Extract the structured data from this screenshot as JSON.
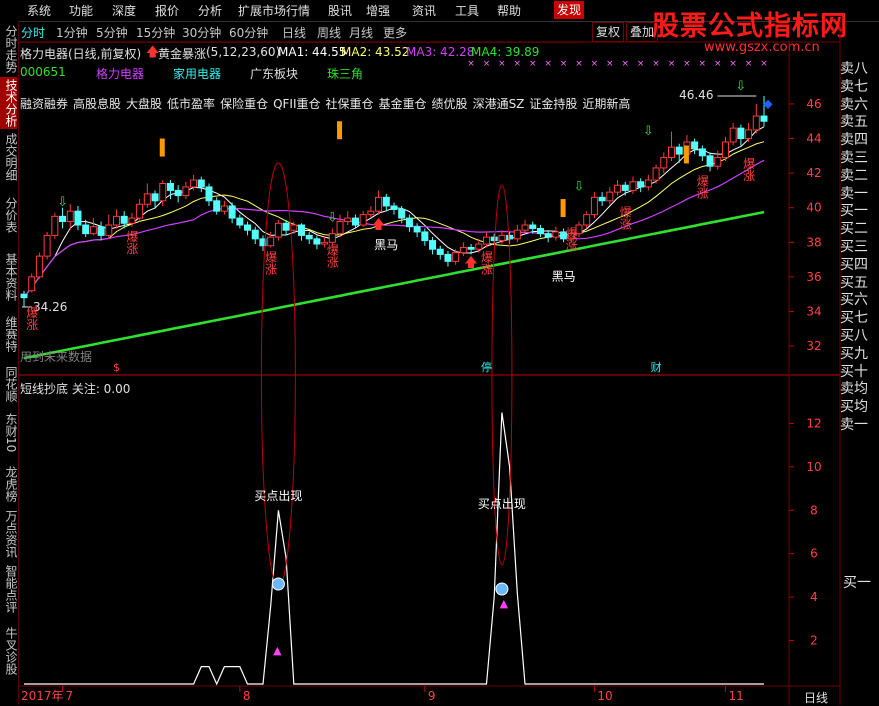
{
  "menu": [
    "系统",
    "功能",
    "深度",
    "报价",
    "分析",
    "扩展市场行情",
    "股讯",
    "增强",
    "资讯",
    "工具",
    "帮助",
    "发现"
  ],
  "logo": {
    "title": "股票公式指标网",
    "url": "www.gszx.com.cn"
  },
  "sidebar": [
    "分时走势",
    "技术分析",
    "成交明细",
    "分价表",
    "基本资料",
    "维赛特",
    "同花顺",
    "东财10",
    "龙虎榜",
    "万点资讯",
    "智能点评",
    "牛叉诊股"
  ],
  "tabs": [
    "分时",
    "1分钟",
    "5分钟",
    "15分钟",
    "30分钟",
    "60分钟",
    "日线",
    "周线",
    "月线",
    "更多"
  ],
  "toolbar": {
    "restore": "复权",
    "overlay": "叠加"
  },
  "stock": {
    "name": "格力电器(日线,前复权)",
    "indicator": "黄金暴涨",
    "params": "(5,12,23,60)",
    "ma1": "MA1: 44.55",
    "ma2": "MA2: 43.52",
    "ma3": "MA3: 42.28",
    "ma4": "MA4: 39.89",
    "code": "000651",
    "tags": [
      "格力电器",
      "家用电器",
      "广东板块",
      "珠三角"
    ]
  },
  "concepts": [
    "融资融券",
    "高股息股",
    "大盘股",
    "低市盈率",
    "保险重仓",
    "QFII重仓",
    "社保重仓",
    "基金重仓",
    "绩优股",
    "深港通SZ",
    "证金持股",
    "近期新高"
  ],
  "annotations": {
    "high": "46.46",
    "low": "34.26",
    "baozhang": "爆涨",
    "heima": "黑马",
    "future": "用到未来数据",
    "ev_s": "$",
    "ev_ting": "停",
    "ev_cai": "财",
    "buy_point": "买点出现"
  },
  "sub_title": "短线抄底 关注: 0.00",
  "orderbook": [
    "卖八",
    "卖七",
    "卖六",
    "卖五",
    "卖四",
    "卖三",
    "卖二",
    "卖一",
    "买一",
    "买二",
    "买三",
    "买四",
    "买五",
    "买六",
    "买七",
    "买八",
    "买九",
    "买十",
    "卖均",
    "买均",
    "卖一"
  ],
  "orderbook_lower": "买一",
  "bottom_period": "日线",
  "colors": {
    "up": "#ff3b3b",
    "down": "#54ffff",
    "ma1": "#ffffff",
    "ma2": "#ffff66",
    "ma3": "#d040ff",
    "ma4": "#30e030",
    "grid": "#700000"
  },
  "chart_data": {
    "type": "candlestick",
    "price_axis": {
      "ylim": [
        30.5,
        47.5
      ],
      "ticks": [
        32,
        34,
        36,
        38,
        40,
        42,
        44,
        46
      ]
    },
    "indicator_axis": {
      "ylim": [
        0,
        13.4
      ],
      "ticks": [
        2,
        4,
        6,
        8,
        10,
        12
      ]
    },
    "month_labels": [
      {
        "label": "2017年",
        "day": 0
      },
      {
        "label": "7",
        "day": 5
      },
      {
        "label": "8",
        "day": 28
      },
      {
        "label": "9",
        "day": 52
      },
      {
        "label": "10",
        "day": 74
      },
      {
        "label": "11",
        "day": 91
      }
    ],
    "ohlc": [
      [
        35.0,
        34.8,
        34.26,
        35.2
      ],
      [
        35.2,
        36.0,
        35.1,
        36.2
      ],
      [
        36.0,
        37.2,
        35.9,
        37.4
      ],
      [
        37.2,
        38.4,
        37.0,
        38.6
      ],
      [
        38.4,
        39.5,
        38.2,
        39.7
      ],
      [
        39.5,
        39.2,
        38.8,
        40.0
      ],
      [
        39.2,
        39.8,
        38.7,
        40.2
      ],
      [
        39.8,
        39.0,
        38.7,
        40.1
      ],
      [
        39.0,
        38.5,
        38.3,
        39.3
      ],
      [
        38.5,
        38.9,
        38.4,
        39.4
      ],
      [
        38.9,
        38.4,
        38.1,
        39.2
      ],
      [
        38.4,
        39.0,
        38.2,
        39.6
      ],
      [
        39.0,
        39.5,
        38.8,
        39.9
      ],
      [
        39.5,
        39.1,
        38.8,
        39.8
      ],
      [
        39.1,
        39.4,
        38.9,
        39.7
      ],
      [
        39.4,
        40.2,
        39.2,
        40.5
      ],
      [
        40.2,
        40.8,
        40.0,
        41.4
      ],
      [
        40.8,
        40.4,
        40.0,
        41.0
      ],
      [
        40.4,
        41.4,
        40.1,
        41.6
      ],
      [
        41.4,
        41.0,
        40.5,
        41.6
      ],
      [
        41.0,
        40.7,
        40.3,
        41.3
      ],
      [
        40.7,
        41.2,
        40.5,
        41.5
      ],
      [
        41.2,
        41.6,
        41.0,
        41.9
      ],
      [
        41.6,
        41.2,
        40.9,
        41.8
      ],
      [
        41.2,
        40.4,
        40.1,
        41.4
      ],
      [
        40.4,
        39.8,
        39.6,
        40.6
      ],
      [
        39.8,
        40.1,
        39.6,
        40.4
      ],
      [
        40.1,
        39.4,
        39.1,
        40.3
      ],
      [
        39.4,
        39.0,
        38.8,
        39.6
      ],
      [
        39.0,
        38.7,
        38.4,
        39.2
      ],
      [
        38.7,
        38.2,
        37.9,
        38.9
      ],
      [
        38.2,
        37.8,
        37.5,
        38.4
      ],
      [
        37.8,
        38.3,
        37.7,
        38.6
      ],
      [
        38.3,
        39.1,
        38.1,
        39.3
      ],
      [
        39.1,
        38.7,
        38.4,
        39.3
      ],
      [
        38.7,
        39.0,
        38.5,
        39.2
      ],
      [
        39.0,
        38.4,
        38.1,
        39.1
      ],
      [
        38.4,
        38.2,
        37.9,
        38.6
      ],
      [
        38.2,
        37.9,
        37.6,
        38.4
      ],
      [
        37.9,
        38.0,
        37.7,
        38.3
      ],
      [
        38.0,
        38.5,
        37.8,
        38.8
      ],
      [
        38.5,
        39.2,
        38.3,
        39.6
      ],
      [
        39.2,
        39.4,
        39.0,
        39.8
      ],
      [
        39.4,
        39.0,
        38.8,
        39.6
      ],
      [
        39.0,
        39.6,
        38.9,
        39.8
      ],
      [
        39.6,
        39.8,
        39.4,
        40.1
      ],
      [
        39.8,
        40.6,
        39.6,
        41.0
      ],
      [
        40.6,
        40.1,
        39.8,
        40.8
      ],
      [
        40.1,
        39.9,
        39.6,
        40.3
      ],
      [
        39.9,
        39.4,
        39.1,
        40.1
      ],
      [
        39.4,
        38.9,
        38.6,
        39.6
      ],
      [
        38.9,
        38.6,
        38.3,
        39.1
      ],
      [
        38.6,
        38.1,
        37.8,
        38.8
      ],
      [
        38.1,
        37.6,
        37.3,
        38.3
      ],
      [
        37.6,
        37.3,
        37.0,
        37.8
      ],
      [
        37.3,
        36.9,
        36.6,
        37.5
      ],
      [
        36.9,
        37.4,
        36.7,
        37.6
      ],
      [
        37.4,
        37.7,
        37.2,
        38.0
      ],
      [
        37.7,
        37.6,
        37.3,
        37.9
      ],
      [
        37.6,
        37.9,
        37.4,
        38.2
      ],
      [
        37.9,
        38.3,
        37.7,
        38.6
      ],
      [
        38.3,
        38.1,
        37.9,
        38.5
      ],
      [
        38.1,
        38.4,
        37.9,
        38.7
      ],
      [
        38.4,
        38.2,
        37.9,
        38.6
      ],
      [
        38.2,
        38.7,
        38.0,
        39.0
      ],
      [
        38.7,
        39.0,
        38.5,
        39.3
      ],
      [
        39.0,
        38.8,
        38.5,
        39.2
      ],
      [
        38.8,
        38.5,
        38.3,
        39.0
      ],
      [
        38.5,
        38.3,
        38.0,
        38.7
      ],
      [
        38.3,
        38.6,
        38.1,
        38.9
      ],
      [
        38.6,
        38.2,
        38.0,
        38.8
      ],
      [
        38.2,
        38.5,
        38.0,
        38.8
      ],
      [
        38.5,
        39.0,
        38.3,
        39.2
      ],
      [
        39.0,
        39.6,
        38.8,
        39.8
      ],
      [
        39.6,
        40.6,
        39.4,
        40.9
      ],
      [
        40.6,
        40.4,
        40.1,
        40.9
      ],
      [
        40.4,
        40.9,
        40.2,
        41.2
      ],
      [
        40.9,
        41.3,
        40.7,
        41.6
      ],
      [
        41.3,
        41.0,
        40.7,
        41.5
      ],
      [
        41.0,
        41.5,
        40.8,
        41.8
      ],
      [
        41.5,
        41.2,
        40.9,
        41.7
      ],
      [
        41.2,
        41.6,
        41.0,
        41.9
      ],
      [
        41.6,
        42.3,
        41.4,
        42.5
      ],
      [
        42.3,
        42.9,
        42.0,
        43.2
      ],
      [
        42.9,
        43.5,
        42.7,
        44.4
      ],
      [
        43.5,
        43.1,
        42.6,
        43.7
      ],
      [
        43.1,
        43.8,
        42.9,
        44.2
      ],
      [
        43.8,
        43.4,
        43.1,
        44.0
      ],
      [
        43.4,
        43.0,
        42.7,
        43.6
      ],
      [
        43.0,
        42.4,
        42.1,
        43.2
      ],
      [
        42.4,
        42.9,
        42.2,
        43.3
      ],
      [
        42.9,
        43.8,
        42.7,
        44.1
      ],
      [
        43.8,
        44.6,
        43.6,
        44.9
      ],
      [
        44.6,
        44.0,
        43.6,
        44.8
      ],
      [
        44.0,
        44.5,
        43.8,
        44.9
      ],
      [
        44.5,
        45.3,
        44.3,
        46.0
      ],
      [
        45.3,
        45.0,
        44.7,
        46.46
      ]
    ],
    "indicator_values": [
      0,
      0,
      0,
      0,
      0,
      0,
      0,
      0,
      0,
      0,
      0,
      0,
      0,
      0,
      0,
      0,
      0,
      0,
      0,
      0,
      0,
      0,
      0,
      0,
      0,
      0,
      0.8,
      0.8,
      0.8,
      0,
      0,
      0,
      3.6,
      8.0,
      5.8,
      0,
      0,
      0,
      0,
      0,
      0,
      0,
      0,
      0,
      0,
      0,
      0,
      0,
      0,
      0,
      0,
      0,
      0,
      0,
      0,
      0,
      0,
      0,
      0,
      0,
      0,
      0,
      0,
      0,
      0,
      0,
      0,
      0,
      0,
      0,
      0,
      0,
      0,
      0,
      0,
      0,
      0,
      0,
      0,
      0,
      0,
      0,
      0,
      0,
      0,
      0,
      0,
      0,
      0,
      0,
      0,
      0,
      0,
      0,
      0,
      0,
      0,
      0
    ],
    "indicator_peaks": [
      {
        "day": 33,
        "value": 8.0
      },
      {
        "day": 63,
        "value": 12.5
      }
    ]
  }
}
